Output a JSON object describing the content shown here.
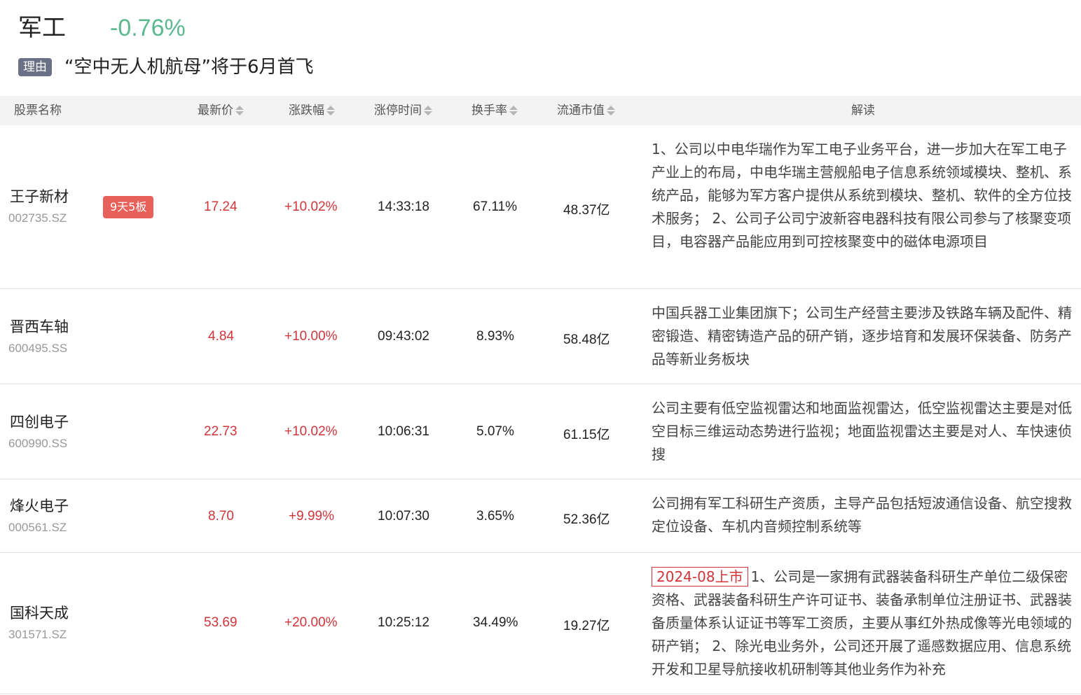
{
  "sector": {
    "name": "军工",
    "change": "-0.76%",
    "reason_tag": "理由",
    "reason_text": "“空中无人机航母”将于6月首飞"
  },
  "table": {
    "headers": {
      "name": "股票名称",
      "price": "最新价",
      "change": "涨跌幅",
      "limit_time": "涨停时间",
      "turnover": "换手率",
      "mktcap": "流通市值",
      "desc": "解读"
    },
    "rows": [
      {
        "name": "王子新材",
        "code": "002735.SZ",
        "badge": "9天5板",
        "price": "17.24",
        "change": "+10.02%",
        "time": "14:33:18",
        "turnover": "67.11%",
        "mktcap": "48.37亿",
        "ipo": "",
        "desc": "1、公司以中电华瑞作为军工电子业务平台，进一步加大在军工电子产业上的布局，中电华瑞主营舰船电子信息系统领域模块、整机、系统产品，能够为军方客户提供从系统到模块、整机、软件的全方位技术服务； 2、公司子公司宁波新容电器科技有限公司参与了核聚变项目，电容器产品能应用到可控核聚变中的磁体电源项目"
      },
      {
        "name": "晋西车轴",
        "code": "600495.SS",
        "badge": "",
        "price": "4.84",
        "change": "+10.00%",
        "time": "09:43:02",
        "turnover": "8.93%",
        "mktcap": "58.48亿",
        "ipo": "",
        "desc": "中国兵器工业集团旗下；公司生产经营主要涉及铁路车辆及配件、精密锻造、精密铸造产品的研产销，逐步培育和发展环保装备、防务产品等新业务板块"
      },
      {
        "name": "四创电子",
        "code": "600990.SS",
        "badge": "",
        "price": "22.73",
        "change": "+10.02%",
        "time": "10:06:31",
        "turnover": "5.07%",
        "mktcap": "61.15亿",
        "ipo": "",
        "desc": "公司主要有低空监视雷达和地面监视雷达，低空监视雷达主要是对低空目标三维运动态势进行监视；地面监视雷达主要是对人、车快速侦搜"
      },
      {
        "name": "烽火电子",
        "code": "000561.SZ",
        "badge": "",
        "price": "8.70",
        "change": "+9.99%",
        "time": "10:07:30",
        "turnover": "3.65%",
        "mktcap": "52.36亿",
        "ipo": "",
        "desc": "公司拥有军工科研生产资质，主导产品包括短波通信设备、航空搜救定位设备、车机内音频控制系统等"
      },
      {
        "name": "国科天成",
        "code": "301571.SZ",
        "badge": "",
        "price": "53.69",
        "change": "+20.00%",
        "time": "10:25:12",
        "turnover": "34.49%",
        "mktcap": "19.27亿",
        "ipo": "2024-08上市",
        "desc": "1、公司是一家拥有武器装备科研生产单位二级保密资格、武器装备科研生产许可证书、装备承制单位注册证书、武器装备质量体系认证证书等军工资质，主要从事红外热成像等光电领域的研产销； 2、除光电业务外，公司还开展了遥感数据应用、信息系统开发和卫星导航接收机研制等其他业务作为补充"
      }
    ]
  }
}
